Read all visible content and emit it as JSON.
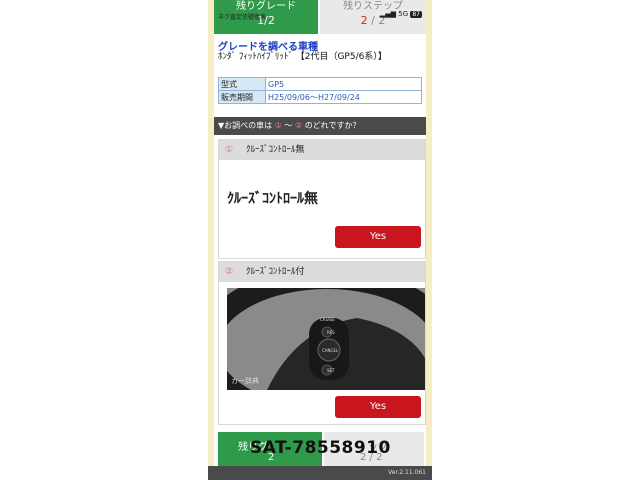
{
  "tabs": {
    "grade_label": "残りグレード",
    "grade_count": "2",
    "grade_prefix": "1/2",
    "step_label": "残りステップ",
    "step_current": "2",
    "step_total": "/ 2"
  },
  "statusbar": {
    "left_text": "ネク直定信號復表",
    "network": "5G",
    "battery": "87"
  },
  "heading": "グレードを調べる車種",
  "model": "ﾎﾝﾀﾞ ﾌｨｯﾄﾊｲﾌﾞﾘｯﾄﾞ 【2代目（GP5/6系）】",
  "spec": [
    {
      "key": "型式",
      "value": "GP5"
    },
    {
      "key": "販売期間",
      "value": "H25/09/06〜H27/09/24"
    }
  ],
  "question": {
    "prefix": "▼お調べの車は",
    "n1": "①",
    "tilde": "〜",
    "n2": "②",
    "suffix": "のどれですか？"
  },
  "options": [
    {
      "num": "①",
      "title": "ｸﾙｰｽﾞｺﾝﾄﾛｰﾙ無",
      "body": "ｸﾙｰｽﾞｺﾝﾄﾛｰﾙ無",
      "button": "Yes"
    },
    {
      "num": "②",
      "title": "ｸﾙｰｽﾞｺﾝﾄﾛｰﾙ付",
      "button": "Yes",
      "watermark": "カー辞典"
    }
  ],
  "bottom_tabs": {
    "grade_label": "残りグ",
    "grade_count": "2",
    "step_label": "ップ",
    "step_count": "2 / 2"
  },
  "version": "Ver.2.11.061",
  "overlay_text": "SAT-78558910"
}
